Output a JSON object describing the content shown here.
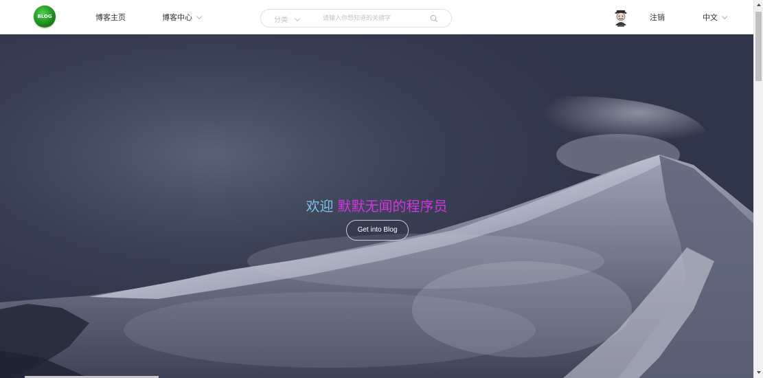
{
  "navbar": {
    "logo_text": "BLOG",
    "home_label": "博客主页",
    "center_label": "博客中心",
    "search": {
      "category_label": "分类",
      "placeholder": "请输入你想知道的关键字"
    },
    "logout_label": "注销",
    "language_label": "中文"
  },
  "hero": {
    "welcome_prefix": "欢迎",
    "welcome_name": "默默无闻的程序员",
    "enter_button_label": "Get into Blog"
  },
  "icons": {
    "logo": "blog-logo-icon",
    "search": "search-icon",
    "avatar": "user-avatar-icon",
    "dropdown": "chevron-down-icon"
  },
  "colors": {
    "welcome_prefix": "#7ec0e8",
    "welcome_name": "#d633e3",
    "logo_green": "#1f8f1e"
  }
}
